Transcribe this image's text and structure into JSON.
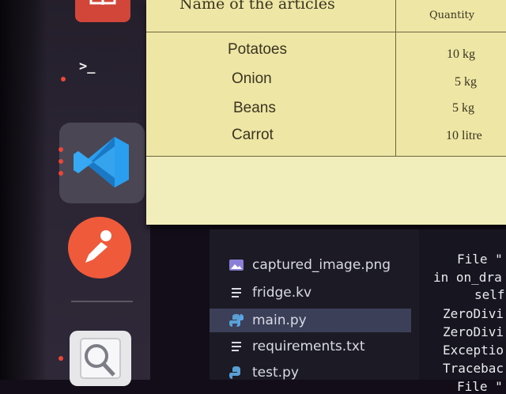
{
  "dock": {
    "terminal_glyph": ">_",
    "items": [
      {
        "name": "ubuntu-software",
        "icon": "shopping-bag-icon",
        "color": "#d2463a"
      },
      {
        "name": "terminal",
        "icon": "terminal-icon"
      },
      {
        "name": "vscode",
        "icon": "vscode-icon",
        "color": "#2a9ff0",
        "running_instances": 3
      },
      {
        "name": "postman",
        "icon": "postman-icon",
        "color": "#ef5b3a"
      },
      {
        "name": "image-viewer",
        "icon": "magnifier-icon"
      }
    ]
  },
  "document": {
    "header_name": "Name of the articles",
    "header_quantity": "Quantity",
    "rows": [
      {
        "item": "Potatoes",
        "quantity": "10 kg"
      },
      {
        "item": "Onion",
        "quantity": "5 kg"
      },
      {
        "item": "Beans",
        "quantity": "5 kg"
      },
      {
        "item": "Carrot",
        "quantity": "10 litre"
      }
    ]
  },
  "explorer": {
    "files": [
      {
        "name": "captured_image.png",
        "icon": "image-file-icon"
      },
      {
        "name": "fridge.kv",
        "icon": "text-file-icon"
      },
      {
        "name": "main.py",
        "icon": "python-file-icon",
        "selected": true
      },
      {
        "name": "requirements.txt",
        "icon": "text-file-icon"
      },
      {
        "name": "test.py",
        "icon": "python-file-icon"
      }
    ]
  },
  "terminal": {
    "lines": [
      "File \"",
      "in on_dra",
      "self",
      "ZeroDivi",
      "ZeroDivi",
      "Exceptio",
      "Tracebac",
      "File \""
    ]
  },
  "colors": {
    "document_bg": "#ede6a5",
    "explorer_selected": "#3b3f57",
    "vscode_blue": "#2a9ff0",
    "running_indicator": "#e8473a"
  }
}
